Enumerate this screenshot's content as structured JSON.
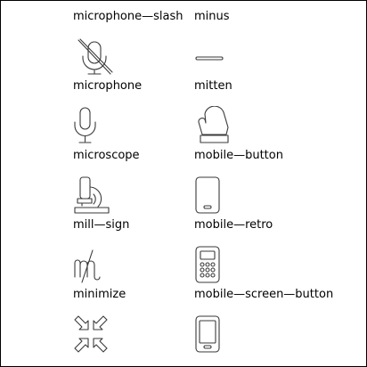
{
  "icons": [
    {
      "label": "microphone—slash",
      "icon": "microphone-slash-icon"
    },
    {
      "label": "minus",
      "icon": "minus-icon"
    },
    {
      "label": "microphone",
      "icon": "microphone-icon"
    },
    {
      "label": "mitten",
      "icon": "mitten-icon"
    },
    {
      "label": "microscope",
      "icon": "microscope-icon"
    },
    {
      "label": "mobile—button",
      "icon": "mobile-button-icon"
    },
    {
      "label": "mill—sign",
      "icon": "mill-sign-icon"
    },
    {
      "label": "mobile—retro",
      "icon": "mobile-retro-icon"
    },
    {
      "label": "minimize",
      "icon": "minimize-icon"
    },
    {
      "label": "mobile—screen—button",
      "icon": "mobile-screen-button-icon"
    }
  ]
}
